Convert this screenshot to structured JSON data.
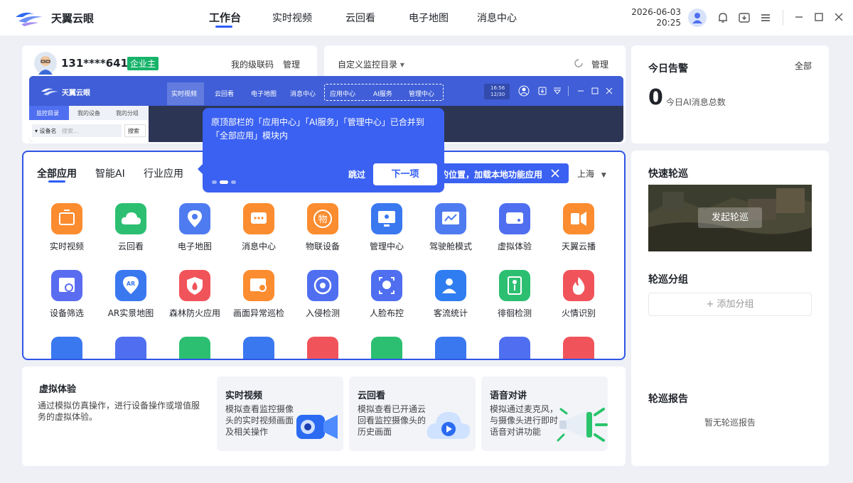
{
  "app": {
    "title": "天翼云眼"
  },
  "nav": {
    "tabs": [
      "工作台",
      "实时视频",
      "云回看",
      "电子地图",
      "消息中心"
    ],
    "active": 0
  },
  "datetime": {
    "date": "2026-06-03",
    "time": "20:25"
  },
  "user": {
    "phone": "131****6416",
    "role_badge": "企业主",
    "link_level_code": "我的级联码",
    "link_manage": "管理"
  },
  "monitor": {
    "title": "自定义监控目录",
    "caret": "▾",
    "manage": "管理"
  },
  "mini_ui": {
    "title": "天翼云眼",
    "tabs": [
      "实时视频",
      "云回看",
      "电子地图",
      "消息中心"
    ],
    "highlighted_tabs": [
      "应用中心",
      "AI服务",
      "管理中心"
    ],
    "time": "16:56",
    "date": "12/30",
    "side_tabs": [
      "监控目录",
      "我的设备",
      "我的分组"
    ],
    "device_label": "▾ 设备名",
    "search_placeholder": "搜索...",
    "search_btn": "搜索"
  },
  "guide": {
    "text": "原顶部栏的「应用中心」「AI服务」「管理中心」已合并到「全部应用」模块内",
    "skip": "跳过",
    "next": "下一项",
    "step": 2,
    "steps": 3
  },
  "apps_panel": {
    "tabs": [
      "全部应用",
      "智能AI",
      "行业应用"
    ],
    "notice": "的位置，加载本地功能应用",
    "location": "上海",
    "row1": [
      {
        "label": "实时视频",
        "color": "#fb8c2f",
        "icon": "video-icon"
      },
      {
        "label": "云回看",
        "color": "#2cbf72",
        "icon": "cloud-icon"
      },
      {
        "label": "电子地图",
        "color": "#4f7bf0",
        "icon": "map-pin-icon"
      },
      {
        "label": "消息中心",
        "color": "#fb8c2f",
        "icon": "message-icon"
      },
      {
        "label": "物联设备",
        "color": "#fb8c2f",
        "icon": "iot-icon"
      },
      {
        "label": "管理中心",
        "color": "#3a78f0",
        "icon": "monitor-icon"
      },
      {
        "label": "驾驶舱模式",
        "color": "#4f7bf0",
        "icon": "dashboard-icon"
      },
      {
        "label": "虚拟体验",
        "color": "#4f6ff0",
        "icon": "virtual-icon"
      },
      {
        "label": "天翼云播",
        "color": "#fb8c2f",
        "icon": "broadcast-icon"
      }
    ],
    "row2": [
      {
        "label": "设备筛选",
        "color": "#5a6cf0",
        "icon": "filter-icon"
      },
      {
        "label": "AR实景地图",
        "color": "#3a78f0",
        "icon": "ar-map-icon"
      },
      {
        "label": "森林防火应用",
        "color": "#f0545a",
        "icon": "fire-shield-icon"
      },
      {
        "label": "画面异常巡检",
        "color": "#fb8c2f",
        "icon": "inspect-icon"
      },
      {
        "label": "入侵检测",
        "color": "#4f6ff0",
        "icon": "intrusion-icon"
      },
      {
        "label": "人脸布控",
        "color": "#4f6ff0",
        "icon": "face-icon"
      },
      {
        "label": "客流统计",
        "color": "#2f7df0",
        "icon": "people-icon"
      },
      {
        "label": "徘徊检测",
        "color": "#2cbf72",
        "icon": "wander-icon"
      },
      {
        "label": "火情识别",
        "color": "#f0545a",
        "icon": "flame-icon"
      }
    ],
    "row3_colors": [
      "#3a78f0",
      "#4f6ff0",
      "#2cbf72",
      "#3a78f0",
      "#f0545a",
      "#2cbf72",
      "#3a78f0",
      "#4f6ff0",
      "#f0545a"
    ]
  },
  "alarm": {
    "title": "今日告警",
    "all": "全部",
    "count": "0",
    "count_label": "今日AI消息总数"
  },
  "patrol": {
    "quick_title": "快速轮巡",
    "start": "发起轮巡",
    "group_title": "轮巡分组",
    "add_group": "+ 添加分组",
    "report_title": "轮巡报告",
    "report_empty": "暂无轮巡报告"
  },
  "virtual": {
    "title": "虚拟体验",
    "desc": "通过模拟仿真操作，进行设备操作或增值服务的虚拟体验。",
    "cards": [
      {
        "title": "实时视频",
        "desc": "模拟查看监控摄像头的实时视频画面及相关操作"
      },
      {
        "title": "云回看",
        "desc": "模拟查看已开通云回看监控摄像头的历史画面"
      },
      {
        "title": "语音对讲",
        "desc": "模拟通过麦克风，与摄像头进行即时语音对讲功能"
      }
    ]
  }
}
